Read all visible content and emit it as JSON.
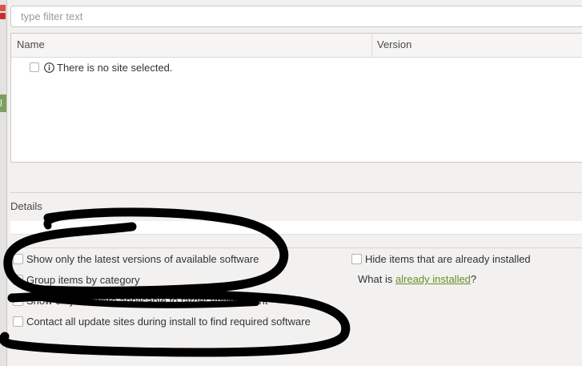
{
  "filter": {
    "placeholder": "type filter text"
  },
  "table": {
    "columns": [
      "Name",
      "Version"
    ],
    "rows": [
      {
        "label": "There is no site selected.",
        "checked": false,
        "icon": "info-icon"
      }
    ]
  },
  "details": {
    "label": "Details"
  },
  "options": {
    "latest_versions": {
      "label": "Show only the latest versions of available software",
      "checked": false
    },
    "group_by_category": {
      "label": "Group items by category",
      "checked": false
    },
    "applicable_only": {
      "label": "Show only software applicable to target environment",
      "checked": false
    },
    "contact_sites": {
      "label": "Contact all update sites during install to find required software",
      "checked": false
    },
    "hide_installed": {
      "label": "Hide items that are already installed",
      "checked": false
    }
  },
  "installed_info": {
    "prefix": "What is ",
    "link": "already installed",
    "suffix": "?"
  },
  "colors": {
    "link": "#6b8e23",
    "scribble": "#000000"
  }
}
